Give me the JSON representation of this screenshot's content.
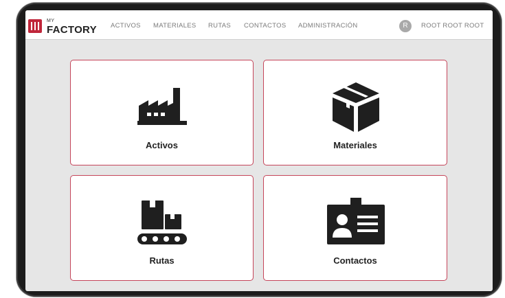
{
  "brand": {
    "small": "MY",
    "name": "FACTORY",
    "accent": "#c0263a"
  },
  "nav": {
    "items": [
      {
        "label": "ACTIVOS"
      },
      {
        "label": "MATERIALES"
      },
      {
        "label": "RUTAS"
      },
      {
        "label": "CONTACTOS"
      },
      {
        "label": "ADMINISTRACIÓN"
      }
    ],
    "avatar_initial": "R",
    "user_name": "ROOT ROOT ROOT"
  },
  "cards": [
    {
      "label": "Activos",
      "icon": "factory-icon"
    },
    {
      "label": "Materiales",
      "icon": "box-icon"
    },
    {
      "label": "Rutas",
      "icon": "conveyor-icon"
    },
    {
      "label": "Contactos",
      "icon": "id-card-icon"
    }
  ],
  "colors": {
    "card_border": "#c54459",
    "icon": "#1f1f1f",
    "background": "#e6e6e6"
  }
}
